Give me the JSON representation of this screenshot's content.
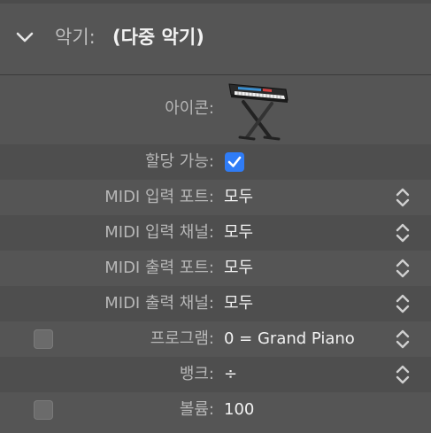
{
  "header": {
    "label": "악기:",
    "value": "(다중 악기)"
  },
  "rows": {
    "icon": {
      "label": "아이콘:",
      "icon_name": "keyboard-synth-icon"
    },
    "assignable": {
      "label": "할당 가능:",
      "checked": true
    },
    "midi_in_port": {
      "label": "MIDI 입력 포트:",
      "value": "모두"
    },
    "midi_in_channel": {
      "label": "MIDI 입력 채널:",
      "value": "모두"
    },
    "midi_out_port": {
      "label": "MIDI 출력 포트:",
      "value": "모두"
    },
    "midi_out_channel": {
      "label": "MIDI 출력 채널:",
      "value": "모두"
    },
    "program": {
      "label": "프로그램:",
      "value": "0 = Grand Piano",
      "enabled": false
    },
    "bank": {
      "label": "뱅크:",
      "value": "÷"
    },
    "volume": {
      "label": "볼륨:",
      "value": "100",
      "enabled": false
    }
  },
  "colors": {
    "accent": "#2f7cf6",
    "background": "#525252",
    "label_text": "#b7b7b7",
    "value_text": "#f2f2f2"
  }
}
